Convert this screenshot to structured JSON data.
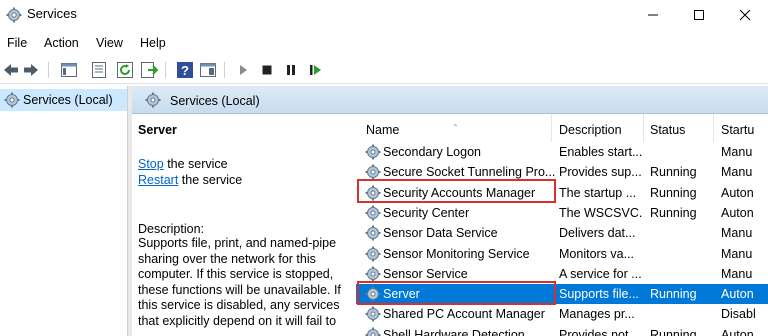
{
  "window": {
    "title": "Services"
  },
  "menu": [
    "File",
    "Action",
    "View",
    "Help"
  ],
  "tree": {
    "item": "Services (Local)"
  },
  "pane_header": {
    "title": "Services (Local)"
  },
  "detail": {
    "service_name": "Server",
    "stop_link": "Stop",
    "stop_suffix": " the service",
    "restart_link": "Restart",
    "restart_suffix": " the service",
    "description_label": "Description:",
    "description_text": "Supports file, print, and named-pipe sharing over the network for this computer. If this service is stopped, these functions will be unavailable. If this service is disabled, any services that explicitly depend on it will fail to"
  },
  "columns": {
    "name": "Name",
    "description": "Description",
    "status": "Status",
    "startup": "Startu"
  },
  "rows": [
    {
      "name": "Secondary Logon",
      "description": "Enables start...",
      "status": "",
      "startup": "Manu"
    },
    {
      "name": "Secure Socket Tunneling Pro...",
      "description": "Provides sup...",
      "status": "Running",
      "startup": "Manu"
    },
    {
      "name": "Security Accounts Manager",
      "description": "The startup ...",
      "status": "Running",
      "startup": "Auton"
    },
    {
      "name": "Security Center",
      "description": "The WSCSVC...",
      "status": "Running",
      "startup": "Auton"
    },
    {
      "name": "Sensor Data Service",
      "description": "Delivers dat...",
      "status": "",
      "startup": "Manu"
    },
    {
      "name": "Sensor Monitoring Service",
      "description": "Monitors va...",
      "status": "",
      "startup": "Manu"
    },
    {
      "name": "Sensor Service",
      "description": "A service for ...",
      "status": "",
      "startup": "Manu"
    },
    {
      "name": "Server",
      "description": "Supports file...",
      "status": "Running",
      "startup": "Auton"
    },
    {
      "name": "Shared PC Account Manager",
      "description": "Manages pr...",
      "status": "",
      "startup": "Disabl"
    },
    {
      "name": "Shell Hardware Detection",
      "description": "Provides not...",
      "status": "Running",
      "startup": "Auton"
    }
  ],
  "selected_row": "Server",
  "colors": {
    "selection": "#0078d7",
    "highlight_box": "#d9302b",
    "link": "#0066cc"
  }
}
